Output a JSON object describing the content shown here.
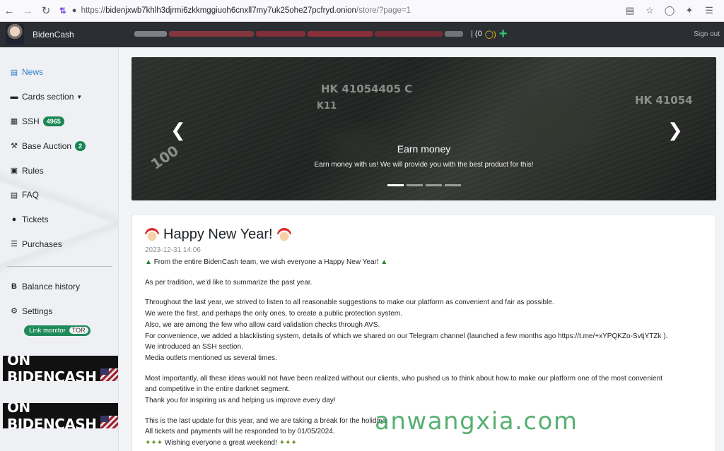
{
  "browser": {
    "url_prefix": "https://",
    "url_host": "bidenjxwb7khlh3djrmi6zkkmggiuoh6cnxll7my7uk25ohe27pcfryd.onion",
    "url_path": "/store/?page=1"
  },
  "header": {
    "brand": "BidenCash",
    "balance_text": "| (0",
    "signout": "Sign out"
  },
  "sidebar": {
    "items": [
      {
        "label": "News",
        "icon": "newspaper-icon"
      },
      {
        "label": "Cards section",
        "icon": "card-icon"
      },
      {
        "label": "SSH",
        "icon": "network-icon",
        "badge": "4965"
      },
      {
        "label": "Base Auction",
        "icon": "hammer-icon",
        "badge": "2"
      },
      {
        "label": "Rules",
        "icon": "book-icon"
      },
      {
        "label": "FAQ",
        "icon": "list-icon"
      },
      {
        "label": "Tickets",
        "icon": "chat-icon"
      },
      {
        "label": "Purchases",
        "icon": "list-icon"
      }
    ],
    "balance_history": "Balance history",
    "settings": "Settings",
    "link_monitor": "Link monitor",
    "tor": "TOR",
    "ad_text": "ON BIDENCASH"
  },
  "carousel": {
    "title": "Earn money",
    "subtitle": "Earn money with us! We will provide you with the best product for this!",
    "active_slide": 1,
    "slides": 4
  },
  "post": {
    "title": "Happy New Year!",
    "date": "2023-12-31 14:06",
    "greeting": "From the entire BidenCash team, we wish everyone a Happy New Year!",
    "p1": "As per tradition, we'd like to summarize the past year.",
    "p2": [
      "Throughout the last year, we strived to listen to all reasonable suggestions to make our platform as convenient and fair as possible.",
      "We were the first, and perhaps the only ones, to create a public protection system.",
      "Also, we are among the few who allow card validation checks through AVS.",
      "For convenience, we added a blacklisting system, details of which we shared on our Telegram channel (launched a few months ago https://t.me/+xYPQKZo-SvtjYTZk ).",
      "We introduced an SSH section.",
      "Media outlets mentioned us several times."
    ],
    "p3": [
      "Most importantly, all these ideas would not have been realized without our clients, who pushed us to think about how to make our platform one of the most convenient",
      "and competitive in the entire darknet segment.",
      "Thank you for inspiring us and helping us improve every day!"
    ],
    "p4": [
      "This is the last update for this year, and we are taking a break for the holidays",
      "All tickets and payments will be responded to by 01/05/2024.",
      "Wishing everyone a great weekend!"
    ]
  },
  "watermark": "anwangxia.com"
}
